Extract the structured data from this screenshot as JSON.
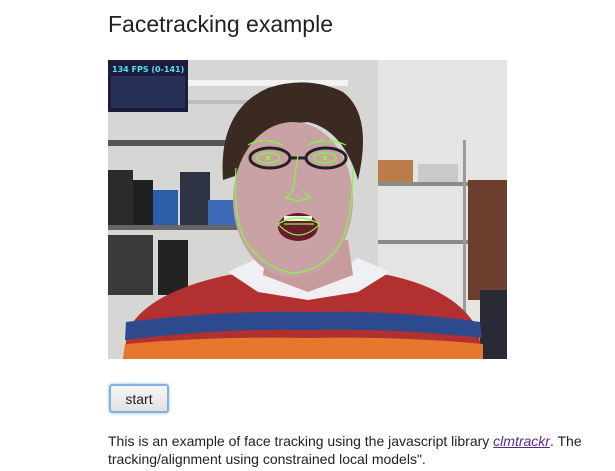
{
  "page": {
    "title": "Facetracking example"
  },
  "video": {
    "fps_label": "134 FPS (0-141)",
    "overlay_color": "#7cff3a",
    "fps_text_color": "#4fe3f0"
  },
  "controls": {
    "start_label": "start"
  },
  "description": {
    "line1_prefix": "This is an example of face tracking using the javascript library ",
    "link_text": "clmtrackr",
    "line1_suffix": ". The",
    "line2": "tracking/alignment using constrained local models\"."
  }
}
